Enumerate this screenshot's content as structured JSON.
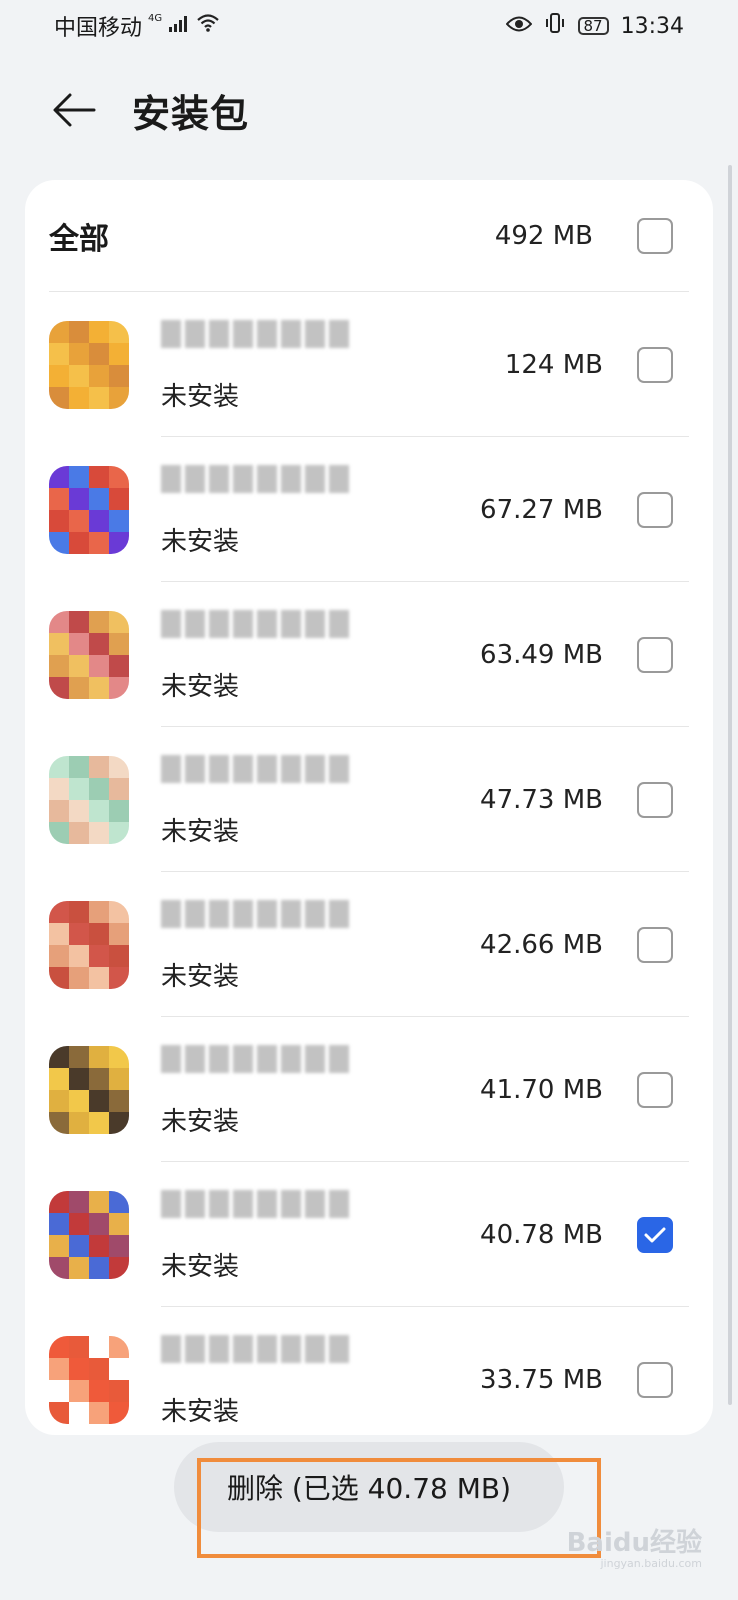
{
  "status_bar": {
    "carrier": "中国移动",
    "network": "4G",
    "battery": "87",
    "time": "13:34"
  },
  "header": {
    "title": "安装包"
  },
  "all_row": {
    "label": "全部",
    "size": "492 MB"
  },
  "items": [
    {
      "size": "124 MB",
      "status": "未安装",
      "checked": false,
      "colors": [
        "#e8a23a",
        "#f5c04a",
        "#f3b035",
        "#d98d3b"
      ]
    },
    {
      "size": "67.27 MB",
      "status": "未安装",
      "checked": false,
      "colors": [
        "#6a3ad6",
        "#e9664a",
        "#d84a3a",
        "#4a7ae6"
      ]
    },
    {
      "size": "63.49 MB",
      "status": "未安装",
      "checked": false,
      "colors": [
        "#e38888",
        "#f0c060",
        "#e0a050",
        "#c04a4a"
      ]
    },
    {
      "size": "47.73 MB",
      "status": "未安装",
      "checked": false,
      "colors": [
        "#bfe5cf",
        "#f3d9c4",
        "#e7b99c",
        "#9ccdb3"
      ]
    },
    {
      "size": "42.66 MB",
      "status": "未安装",
      "checked": false,
      "colors": [
        "#d2564a",
        "#f3c2a2",
        "#e6a07a",
        "#c9503f"
      ]
    },
    {
      "size": "41.70 MB",
      "status": "未安装",
      "checked": false,
      "colors": [
        "#4a3a2a",
        "#f2c84a",
        "#e0b040",
        "#8a6a3a"
      ]
    },
    {
      "size": "40.78 MB",
      "status": "未安装",
      "checked": true,
      "colors": [
        "#c23a3a",
        "#4a6ad6",
        "#e8b04a",
        "#a04a6a"
      ]
    },
    {
      "size": "33.75 MB",
      "status": "未安装",
      "checked": false,
      "colors": [
        "#ef5a3a",
        "#f7a27a",
        "#ffffff",
        "#e85a3a"
      ]
    }
  ],
  "delete_button": {
    "label": "删除 (已选 40.78 MB)"
  },
  "watermark": {
    "text": "Baidu经验",
    "sub": "jingyan.baidu.com"
  }
}
